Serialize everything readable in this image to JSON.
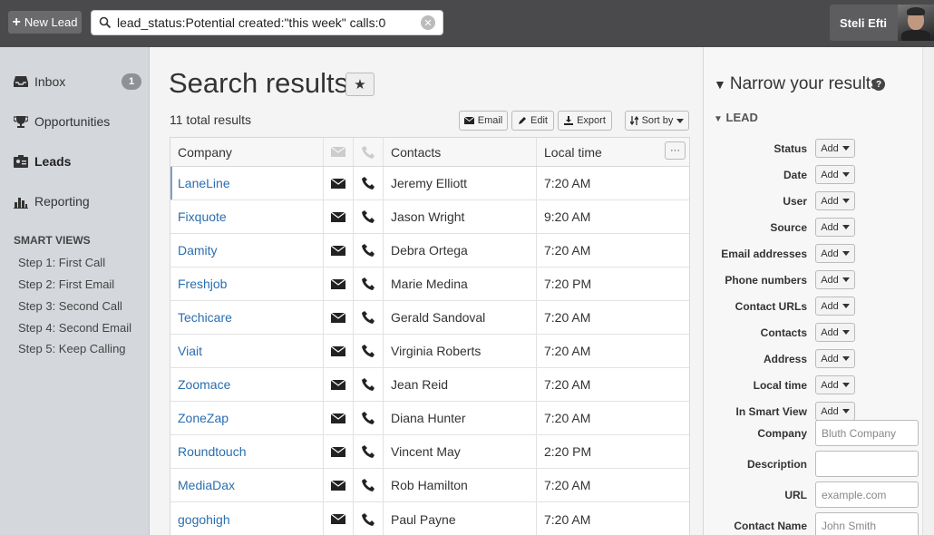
{
  "topbar": {
    "new_lead_label": "New Lead",
    "search_query": "lead_status:Potential created:\"this week\" calls:0",
    "user_name": "Steli Efti"
  },
  "sidebar": {
    "items": [
      {
        "label": "Inbox",
        "icon": "inbox-icon",
        "badge": "1"
      },
      {
        "label": "Opportunities",
        "icon": "trophy-icon"
      },
      {
        "label": "Leads",
        "icon": "leads-icon"
      },
      {
        "label": "Reporting",
        "icon": "bar-chart-icon"
      }
    ],
    "smart_views_heading": "SMART VIEWS",
    "smart_views": [
      "Step 1: First Call",
      "Step 2: First Email",
      "Step 3: Second Call",
      "Step 4: Second Email",
      "Step 5: Keep Calling"
    ]
  },
  "main": {
    "title": "Search results",
    "total": "11 total results",
    "toolbar": {
      "email": "Email",
      "edit": "Edit",
      "export": "Export",
      "sort": "Sort by"
    },
    "columns": {
      "company": "Company",
      "contacts": "Contacts",
      "local_time": "Local time",
      "more": "···"
    },
    "rows": [
      {
        "company": "LaneLine",
        "contact": "Jeremy Elliott",
        "time": "7:20 AM"
      },
      {
        "company": "Fixquote",
        "contact": "Jason Wright",
        "time": "9:20 AM"
      },
      {
        "company": "Damity",
        "contact": "Debra Ortega",
        "time": "7:20 AM"
      },
      {
        "company": "Freshjob",
        "contact": "Marie Medina",
        "time": "7:20 PM"
      },
      {
        "company": "Techicare",
        "contact": "Gerald Sandoval",
        "time": "7:20 AM"
      },
      {
        "company": "Viait",
        "contact": "Virginia Roberts",
        "time": "7:20 AM"
      },
      {
        "company": "Zoomace",
        "contact": "Jean Reid",
        "time": "7:20 AM"
      },
      {
        "company": "ZoneZap",
        "contact": "Diana Hunter",
        "time": "7:20 AM"
      },
      {
        "company": "Roundtouch",
        "contact": "Vincent May",
        "time": "2:20 PM"
      },
      {
        "company": "MediaDax",
        "contact": "Rob Hamilton",
        "time": "7:20 AM"
      },
      {
        "company": "gogohigh",
        "contact": "Paul Payne",
        "time": "7:20 AM"
      }
    ]
  },
  "panel": {
    "title": "Narrow your results",
    "section": "LEAD",
    "add_label": "Add",
    "filters": [
      "Status",
      "Date",
      "User",
      "Source",
      "Email addresses",
      "Phone numbers",
      "Contact URLs",
      "Contacts",
      "Address",
      "Local time",
      "In Smart View"
    ],
    "fields": [
      {
        "label": "Company",
        "placeholder": "Bluth Company"
      },
      {
        "label": "Description",
        "placeholder": ""
      },
      {
        "label": "URL",
        "placeholder": "example.com"
      },
      {
        "label": "Contact Name",
        "placeholder": "John Smith"
      }
    ]
  }
}
